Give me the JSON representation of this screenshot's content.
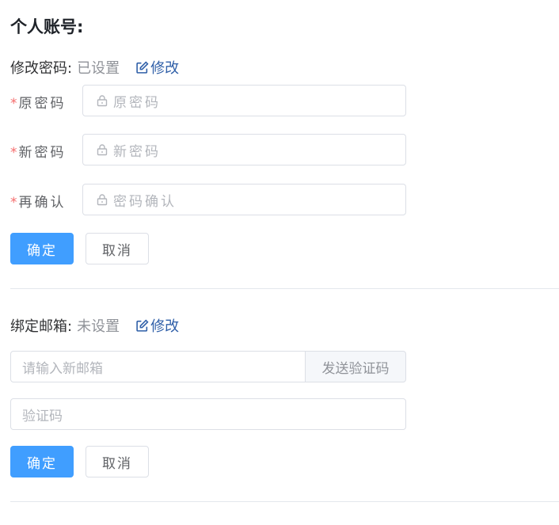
{
  "page": {
    "title": "个人账号:"
  },
  "password": {
    "label": "修改密码:",
    "status": "已设置",
    "edit_label": "修改",
    "fields": [
      {
        "required": "*",
        "label": "原密码",
        "placeholder": "原密码"
      },
      {
        "required": "*",
        "label": "新密码",
        "placeholder": "新密码"
      },
      {
        "required": "*",
        "label": "再确认",
        "placeholder": "密码确认"
      }
    ],
    "confirm_label": "确定",
    "cancel_label": "取消"
  },
  "email": {
    "label": "绑定邮箱:",
    "status": "未设置",
    "edit_label": "修改",
    "email_placeholder": "请输入新邮箱",
    "send_code_label": "发送验证码",
    "code_placeholder": "验证码",
    "confirm_label": "确定",
    "cancel_label": "取消"
  },
  "colors": {
    "primary": "#409eff",
    "link": "#2f5fa8",
    "required": "#f56c6c"
  },
  "icons": {
    "edit": "edit-icon",
    "lock": "lock-icon"
  }
}
